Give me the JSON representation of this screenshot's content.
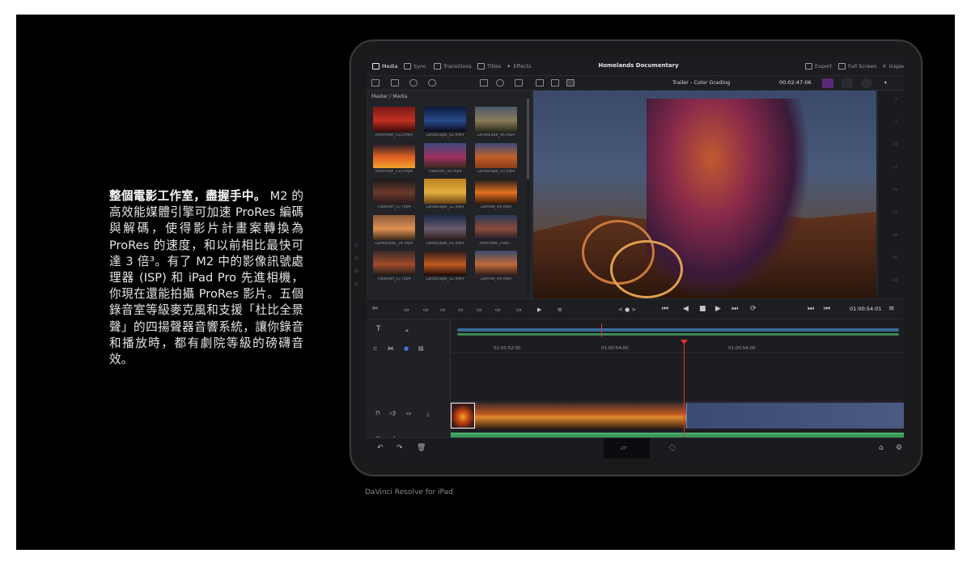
{
  "marketing": {
    "lead": "整個電影工作室，盡握手中。",
    "body": "M2 的高效能媒體引擎可加速 ProRes 編碼與解碼，使得影片計畫案轉換為 ProRes 的速度，和以前相比最快可達 3 倍³。有了 M2 中的影像訊號處理器 (ISP) 和 iPad Pro 先進相機，你現在還能拍攝 ProRes 影片。五個錄音室等級麥克風和支援「杜比全景聲」的四揚聲器音響系統，讓你錄音和播放時，都有劇院等級的磅礴音效。",
    "caption": "DaVinci Resolve for iPad"
  },
  "app": {
    "project_title": "Homelands Documentary",
    "tabs": [
      {
        "label": "Media",
        "icon": "media-icon",
        "active": true
      },
      {
        "label": "Sync",
        "icon": "sync-icon",
        "active": false
      },
      {
        "label": "Transitions",
        "icon": "transitions-icon",
        "active": false
      },
      {
        "label": "Titles",
        "icon": "titles-icon",
        "active": false
      },
      {
        "label": "Effects",
        "icon": "effects-icon",
        "active": false
      }
    ],
    "right_tabs": [
      {
        "label": "Export",
        "icon": "export-icon"
      },
      {
        "label": "Full Screen",
        "icon": "fullscreen-icon"
      },
      {
        "label": "Inspector",
        "icon": "inspector-icon"
      }
    ],
    "timeline_name": "Trailer - Color Grading",
    "viewer_timecode": "00:02:47:06",
    "breadcrumb": "Master / Media",
    "media": [
      {
        "name": "Interview_010.mp4",
        "colors": [
          "#7a1a1a",
          "#c03020",
          "#3a0a0a"
        ]
      },
      {
        "name": "Landscape_02.mp4",
        "colors": [
          "#0a1a3a",
          "#2a4a8a",
          "#0a0a1a"
        ]
      },
      {
        "name": "Landscape_06.mp4",
        "colors": [
          "#4a5a6a",
          "#8a7a5a",
          "#2a2a1a"
        ]
      },
      {
        "name": "Interview_010.mp4",
        "colors": [
          "#1a1a2a",
          "#e06020",
          "#f0a030"
        ]
      },
      {
        "name": "Tradition_06.mp4",
        "colors": [
          "#3a4a7a",
          "#a03060",
          "#3a2a20"
        ]
      },
      {
        "name": "Landscape_03.mp4",
        "colors": [
          "#3a4a7a",
          "#c0602a",
          "#8a3a1a"
        ]
      },
      {
        "name": "Tradition_07.mp4",
        "colors": [
          "#1a1a1a",
          "#6a3a2a",
          "#2a1a1a"
        ]
      },
      {
        "name": "Landscape_12.mp4",
        "colors": [
          "#c08020",
          "#e0b040",
          "#6a4010"
        ]
      },
      {
        "name": "Sunrise_04.mp4",
        "colors": [
          "#1a1a1a",
          "#e07020",
          "#3a1a0a"
        ]
      },
      {
        "name": "Landscape_24.mp4",
        "colors": [
          "#8a5a3a",
          "#e09050",
          "#3a2a1a"
        ]
      },
      {
        "name": "Landscape_01.mp4",
        "colors": [
          "#1a2a4a",
          "#6a5a6a",
          "#2a1a1a"
        ]
      },
      {
        "name": "Interview_Dusk...",
        "colors": [
          "#2a3a5a",
          "#8a4a3a",
          "#1a1a2a"
        ]
      },
      {
        "name": "Tradition_07.mp4",
        "colors": [
          "#3a2a2a",
          "#a04a2a",
          "#1a1a1a"
        ]
      },
      {
        "name": "Landscape_12.mp4",
        "colors": [
          "#2a1a1a",
          "#c05a20",
          "#1a0a0a"
        ]
      },
      {
        "name": "Sunrise_04.mp4",
        "colors": [
          "#3a4a6a",
          "#c06a3a",
          "#2a1a1a"
        ]
      }
    ],
    "scope_ticks": [
      "-0",
      "-5",
      "-10",
      "-15",
      "-20",
      "-25",
      "-30",
      "-40",
      "-50"
    ],
    "transport": {
      "timecode": "01:00:54:01",
      "page_dots": "< ● >"
    },
    "timeline": {
      "ruler": [
        "01:00:52:00",
        "01:00:54:00",
        "01:00:56:00"
      ],
      "tracks": {
        "video": "1",
        "audio": "A1"
      }
    },
    "colors": {
      "accent_playhead": "#e03030",
      "audio_clip": "#3b9a5a",
      "video_track_bar": "#3b6a9a"
    }
  }
}
